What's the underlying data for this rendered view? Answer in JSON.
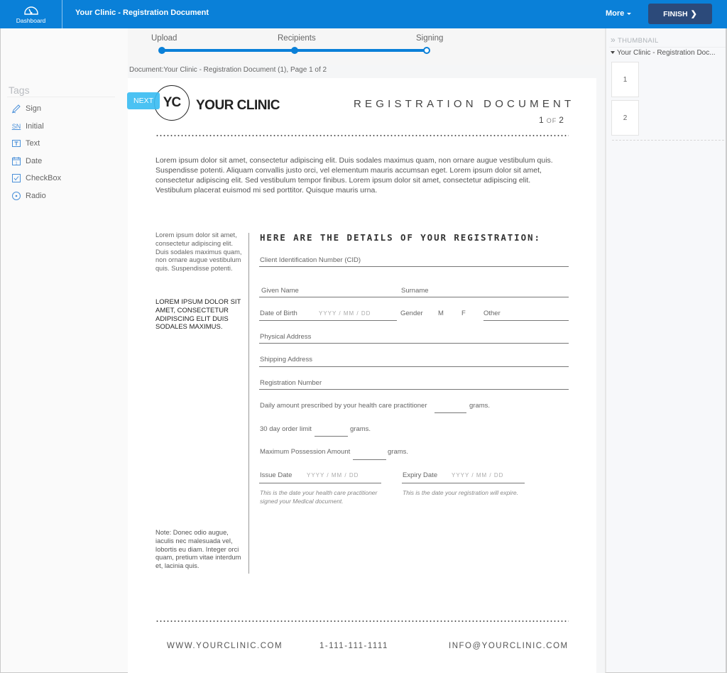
{
  "topbar": {
    "dashboard_label": "Dashboard",
    "document_title": "Your Clinic - Registration Document",
    "more_label": "More",
    "finish_label": "FINISH",
    "brand_color": "#0a80d8",
    "finish_color": "#2c4a7a"
  },
  "tags": {
    "title": "Tags",
    "items": [
      {
        "label": "Sign",
        "icon": "pen-icon"
      },
      {
        "label": "Initial",
        "icon": "initials-icon",
        "glyph": "SN"
      },
      {
        "label": "Text",
        "icon": "text-field-icon"
      },
      {
        "label": "Date",
        "icon": "calendar-icon"
      },
      {
        "label": "CheckBox",
        "icon": "checkbox-icon"
      },
      {
        "label": "Radio",
        "icon": "radio-icon"
      }
    ]
  },
  "progress": {
    "steps": [
      "Upload",
      "Recipients",
      "Signing"
    ],
    "current_step": "Signing"
  },
  "document_info": "Document:Your Clinic - Registration Document (1), Page 1 of 2",
  "next_label": "NEXT",
  "page": {
    "logo_initials": "YC",
    "logo_name": "YOUR CLINIC",
    "title": "REGISTRATION DOCUMENT",
    "page_current": "1",
    "page_of": "OF",
    "page_total": "2",
    "intro": "Lorem ipsum dolor sit amet, consectetur adipiscing elit. Duis sodales maximus quam, non ornare augue vestibulum quis. Suspendisse potenti. Aliquam convallis justo orci, vel elementum mauris accumsan eget. Lorem ipsum dolor sit amet, consectetur adipiscing elit. Sed vestibulum tempor finibus. Lorem ipsum dolor sit amet, consectetur adipiscing elit. Vestibulum placerat euismod mi sed porttitor. Quisque mauris urna.",
    "side_text": "Lorem ipsum dolor sit amet, consectetur adipiscing elit. Duis sodales maximus quam, non ornare augue vestibulum quis. Suspendisse potenti.",
    "side_bold": "LOREM IPSUM DOLOR SIT AMET, CONSECTETUR ADIPISCING ELIT DUIS SODALES MAXIMUS.",
    "side_note": "Note: Donec odio augue, iaculis nec malesuada vel, lobortis eu diam. Integer orci quam, pretium vitae interdum et, lacinia quis.",
    "details_title": "HERE ARE THE DETAILS OF YOUR REGISTRATION:",
    "fields": {
      "cid": "Client Identification Number (CID)",
      "given_name": "Given Name",
      "surname": "Surname",
      "dob": "Date of Birth",
      "date_placeholder": "YYYY  /  MM  /  DD",
      "gender": "Gender",
      "gender_m": "M",
      "gender_f": "F",
      "gender_other": "Other",
      "physical_address": "Physical Address",
      "shipping_address": "Shipping Address",
      "registration_number": "Registration Number",
      "daily_amount": "Daily amount prescribed by your health care practitioner",
      "order_limit": "30 day order limit",
      "max_possession": "Maximum Possession Amount",
      "grams": "grams.",
      "issue_date": "Issue Date",
      "expiry_date": "Expiry Date",
      "issue_hint": "This is the date your health care practitioner signed your Medical document.",
      "expiry_hint": "This is the date your registration will expire."
    },
    "footer": {
      "website": "WWW.YOURCLINIC.COM",
      "phone": "1-111-111-1111",
      "email": "INFO@YOURCLINIC.COM"
    }
  },
  "thumbnail_panel": {
    "title": "THUMBNAIL",
    "document": "Your Clinic - Registration Doc...",
    "pages": [
      "1",
      "2"
    ]
  }
}
